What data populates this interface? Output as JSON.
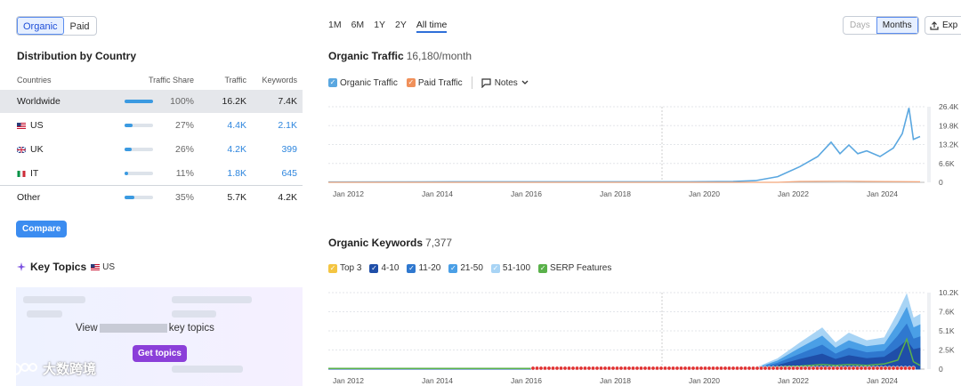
{
  "toggle": {
    "organic": "Organic",
    "paid": "Paid"
  },
  "distribution": {
    "title": "Distribution by Country",
    "headers": {
      "countries": "Countries",
      "share": "Traffic Share",
      "traffic": "Traffic",
      "keywords": "Keywords"
    },
    "rows": [
      {
        "name": "Worldwide",
        "share": "100%",
        "share_fraction": 1.0,
        "traffic": "16.2K",
        "keywords": "7.4K"
      },
      {
        "name": "US",
        "share": "27%",
        "share_fraction": 0.27,
        "traffic": "4.4K",
        "keywords": "2.1K"
      },
      {
        "name": "UK",
        "share": "26%",
        "share_fraction": 0.26,
        "traffic": "4.2K",
        "keywords": "399"
      },
      {
        "name": "IT",
        "share": "11%",
        "share_fraction": 0.11,
        "traffic": "1.8K",
        "keywords": "645"
      },
      {
        "name": "Other",
        "share": "35%",
        "share_fraction": 0.35,
        "traffic": "5.7K",
        "keywords": "4.2K"
      }
    ],
    "compare_label": "Compare"
  },
  "key_topics": {
    "title": "Key Topics",
    "country": "US",
    "view_prefix": "View",
    "view_suffix": "key topics",
    "button": "Get topics"
  },
  "watermark": "大数跨境",
  "time_range": {
    "options": [
      "1M",
      "6M",
      "1Y",
      "2Y",
      "All time"
    ],
    "active": "All time"
  },
  "granularity": {
    "days": "Days",
    "months": "Months"
  },
  "export_label": "Exp",
  "colors": {
    "accent": "#2e6fd8",
    "organic_line": "#5aa7e0",
    "paid_line": "#f4a67a",
    "top3": "#f4c542",
    "pos_4_10": "#1f4ea8",
    "pos_11_20": "#2f78cf",
    "pos_21_50": "#4a9fe6",
    "pos_51_100": "#a8d4f5",
    "serp": "#5ab14a"
  },
  "traffic_chart": {
    "title": "Organic Traffic",
    "value": "16,180/month",
    "legend": {
      "organic": "Organic Traffic",
      "paid": "Paid Traffic",
      "notes": "Notes"
    }
  },
  "keywords_chart": {
    "title": "Organic Keywords",
    "value": "7,377",
    "legend": {
      "top3": "Top 3",
      "p4_10": "4-10",
      "p11_20": "11-20",
      "p21_50": "21-50",
      "p51_100": "51-100",
      "serp": "SERP Features"
    }
  },
  "chart_data": [
    {
      "type": "line",
      "title": "Organic Traffic",
      "x_ticks": [
        "Jan 2012",
        "Jan 2014",
        "Jan 2016",
        "Jan 2018",
        "Jan 2020",
        "Jan 2022",
        "Jan 2024"
      ],
      "y_ticks": [
        "0",
        "6.6K",
        "13.2K",
        "19.8K",
        "26.4K"
      ],
      "ylim": [
        0,
        26400
      ],
      "xlim": [
        2011.9,
        2025.3
      ],
      "grid": true,
      "series": [
        {
          "name": "Organic Traffic",
          "x": [
            2011.9,
            2014.0,
            2016.0,
            2018.0,
            2020.0,
            2021.0,
            2021.5,
            2022.0,
            2022.5,
            2022.9,
            2023.2,
            2023.4,
            2023.6,
            2023.8,
            2024.0,
            2024.3,
            2024.6,
            2024.8,
            2024.95,
            2025.05,
            2025.2
          ],
          "y": [
            100,
            150,
            200,
            200,
            200,
            300,
            600,
            2000,
            5500,
            9000,
            14000,
            10000,
            13000,
            10000,
            11000,
            9000,
            12000,
            17000,
            26000,
            15000,
            16000
          ]
        },
        {
          "name": "Paid Traffic",
          "x": [
            2011.9,
            2022.0,
            2022.5,
            2023.5,
            2024.0,
            2025.2
          ],
          "y": [
            0,
            0,
            300,
            400,
            300,
            200
          ]
        }
      ]
    },
    {
      "type": "area",
      "title": "Organic Keywords",
      "x_ticks": [
        "Jan 2012",
        "Jan 2014",
        "Jan 2016",
        "Jan 2018",
        "Jan 2020",
        "Jan 2022",
        "Jan 2024"
      ],
      "y_ticks": [
        "0",
        "2.5K",
        "5.1K",
        "7.6K",
        "10.2K"
      ],
      "ylim": [
        0,
        10200
      ],
      "xlim": [
        2011.9,
        2025.3
      ],
      "grid": true,
      "x": [
        2011.9,
        2016.5,
        2020.0,
        2021.5,
        2022.0,
        2022.5,
        2023.0,
        2023.3,
        2023.6,
        2024.0,
        2024.4,
        2024.7,
        2024.9,
        2025.05,
        2025.2
      ],
      "series": [
        {
          "name": "51-100",
          "values": [
            0,
            0,
            50,
            150,
            1400,
            3500,
            5500,
            3500,
            4800,
            3800,
            4200,
            7500,
            10000,
            6800,
            7300
          ]
        },
        {
          "name": "21-50",
          "values": [
            0,
            0,
            40,
            100,
            1100,
            2800,
            4400,
            2800,
            3800,
            3000,
            3300,
            6000,
            8200,
            5500,
            5900
          ]
        },
        {
          "name": "11-20",
          "values": [
            0,
            0,
            30,
            80,
            800,
            2000,
            3200,
            2000,
            2800,
            2200,
            2400,
            4400,
            6000,
            4000,
            4300
          ]
        },
        {
          "name": "4-10",
          "values": [
            0,
            0,
            20,
            50,
            500,
            1300,
            2000,
            1300,
            1800,
            1400,
            1600,
            2800,
            3800,
            2600,
            2800
          ]
        },
        {
          "name": "SERP Features",
          "values": [
            100,
            100,
            100,
            150,
            300,
            400,
            600,
            500,
            600,
            500,
            700,
            1200,
            4000,
            1000,
            500
          ]
        }
      ]
    }
  ]
}
